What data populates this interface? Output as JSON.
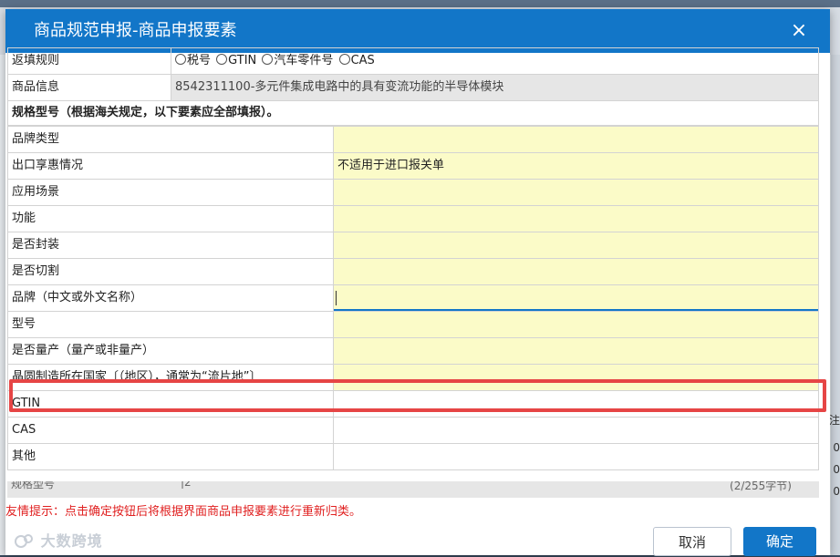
{
  "dialog": {
    "title": "商品规范申报-商品申报要素",
    "close_glyph": "×"
  },
  "rules_row": {
    "label": "返填规则",
    "options": [
      "税号",
      "GTIN",
      "汽车零件号",
      "CAS"
    ]
  },
  "product_info": {
    "label": "商品信息",
    "value": "8542311100-多元件集成电路中的具有变流功能的半导体模块"
  },
  "section_title": "规格型号（根据海关规定，以下要素应全部填报）。",
  "elements": [
    {
      "label": "品牌类型",
      "value": "",
      "style": "yellow"
    },
    {
      "label": "出口享惠情况",
      "value": "不适用于进口报关单",
      "style": "yellow"
    },
    {
      "label": "应用场景",
      "value": "",
      "style": "yellow"
    },
    {
      "label": "功能",
      "value": "",
      "style": "yellow"
    },
    {
      "label": "是否封装",
      "value": "",
      "style": "yellow"
    },
    {
      "label": "是否切割",
      "value": "",
      "style": "yellow"
    },
    {
      "label": "品牌（中文或外文名称）",
      "value": "",
      "style": "yellow-focus"
    },
    {
      "label": "型号",
      "value": "",
      "style": "yellow"
    },
    {
      "label": "是否量产（量产或非量产）",
      "value": "",
      "style": "yellow"
    },
    {
      "label": "晶圆制造所在国家〔（地区），通常为“流片地”〕",
      "value": "",
      "style": "yellow"
    },
    {
      "label": "GTIN",
      "value": "",
      "style": "white"
    },
    {
      "label": "CAS",
      "value": "",
      "style": "white"
    },
    {
      "label": "其他",
      "value": "",
      "style": "white"
    }
  ],
  "spec_row": {
    "label": "规格型号",
    "value": "|2",
    "counter": "(2/255字节)"
  },
  "tip": "友情提示：点击确定按钮后将根据界面商品申报要素进行重新归类。",
  "buttons": {
    "cancel": "取消",
    "ok": "确定"
  },
  "watermark": "大数跨境",
  "background_right_text": [
    "注",
    "0",
    "0",
    "0"
  ],
  "colors": {
    "header": "#1276c8",
    "required_field": "#fbfbc8",
    "readonly_field": "#e6e6e6",
    "highlight": "#e64545",
    "tip": "#e02020"
  }
}
